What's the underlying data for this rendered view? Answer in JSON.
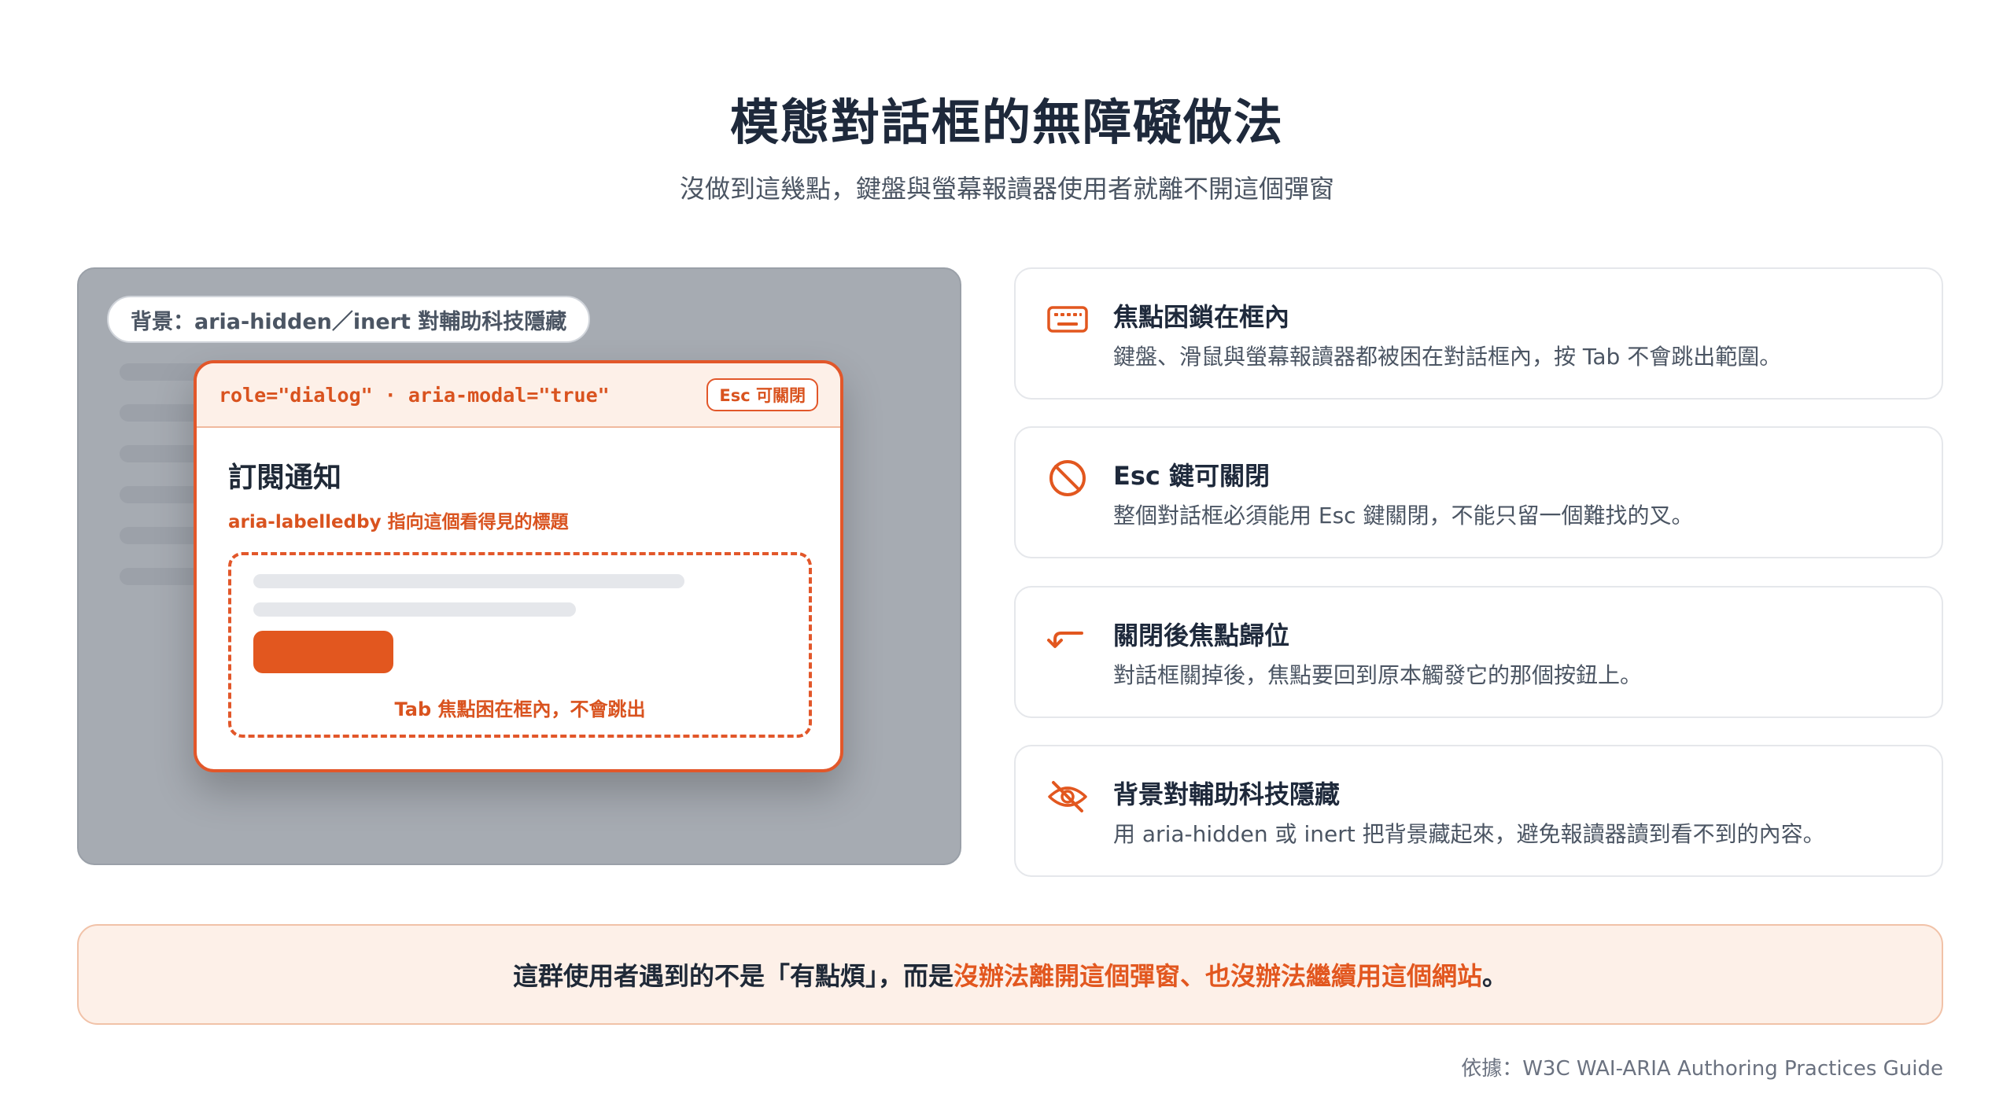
{
  "header": {
    "title": "模態對話框的無障礙做法",
    "subtitle": "沒做到這幾點，鍵盤與螢幕報讀器使用者就離不開這個彈窗"
  },
  "illustration": {
    "background_pill": "背景：aria-hidden／inert 對輔助科技隱藏",
    "dialog_role": "role=\"dialog\" · aria-modal=\"true\"",
    "esc_badge": "Esc 可關閉",
    "dialog_title": "訂閱通知",
    "dialog_label_note": "aria-labelledby 指向這個看得見的標題",
    "focus_trap_note": "Tab 焦點困在框內，不會跳出"
  },
  "cards": [
    {
      "icon": "keyboard-icon",
      "title": "焦點困鎖在框內",
      "desc": "鍵盤、滑鼠與螢幕報讀器都被困在對話框內，按 Tab 不會跳出範圍。"
    },
    {
      "icon": "prohibited-icon",
      "title": "Esc 鍵可關閉",
      "desc": "整個對話框必須能用 Esc 鍵關閉，不能只留一個難找的叉。"
    },
    {
      "icon": "return-arrow-icon",
      "title": "關閉後焦點歸位",
      "desc": "對話框關掉後，焦點要回到原本觸發它的那個按鈕上。"
    },
    {
      "icon": "eye-off-icon",
      "title": "背景對輔助科技隱藏",
      "desc": "用 aria-hidden 或 inert 把背景藏起來，避免報讀器讀到看不到的內容。"
    }
  ],
  "banner": {
    "lead": "這群使用者遇到的不是「有點煩」，而是",
    "accent": "沒辦法離開這個彈窗、也沒辦法繼續用這個網站",
    "tail": "。"
  },
  "source": "依據：W3C WAI-ARIA Authoring Practices Guide",
  "colors": {
    "accent": "#e2571f",
    "panel_bg": "#a6abb2",
    "banner_bg": "#fdf0e8"
  }
}
